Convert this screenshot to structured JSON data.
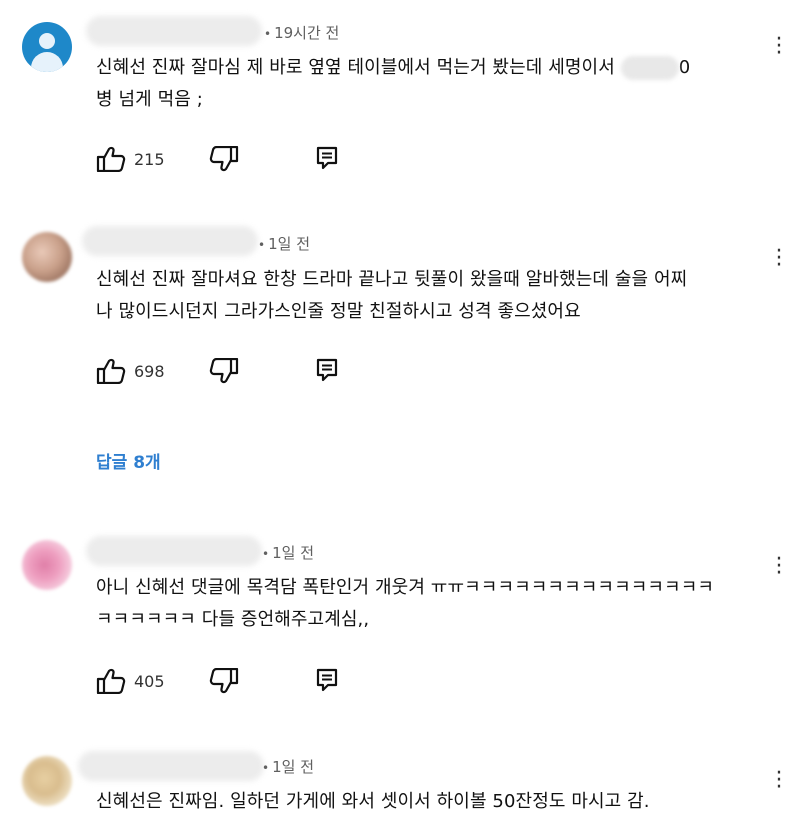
{
  "comments": [
    {
      "time": "19시간 전",
      "text_line1": "신혜선 진짜 잘마심 제 바로 옆옆 테이블에서 먹는거 봤는데 세명이서",
      "text_line1_tail": "0",
      "text_line2": "병 넘게 먹음 ;",
      "likes": "215",
      "avatar": "default-user-avatar"
    },
    {
      "time": "1일 전",
      "text_line1": "신혜선 진짜 잘마셔요 한창 드라마 끝나고 뒷풀이 왔을때 알바했는데 술을 어찌",
      "text_line2": "나 많이드시던지 그라가스인줄 정말 친절하시고 성격 좋으셨어요",
      "likes": "698",
      "replies": "답글 8개"
    },
    {
      "time": "1일 전",
      "text_line1": "아니 신혜선 댓글에 목격담 폭탄인거 개웃겨 ㅠㅠㅋㅋㅋㅋㅋㅋㅋㅋㅋㅋㅋㅋㅋㅋㅋ",
      "text_line2": "ㅋㅋㅋㅋㅋㅋ 다들 증언해주고계심,,",
      "likes": "405"
    },
    {
      "time": "1일 전",
      "text_line1": "신혜선은 진짜임. 일하던 가게에 와서 셋이서 하이볼 50잔정도 마시고 감."
    }
  ],
  "colors": {
    "link": "#2f7fd0",
    "meta": "#606060",
    "avatar_default": "#1e88c9"
  },
  "icons": [
    "like-icon",
    "dislike-icon",
    "reply-icon",
    "more-options-icon"
  ]
}
